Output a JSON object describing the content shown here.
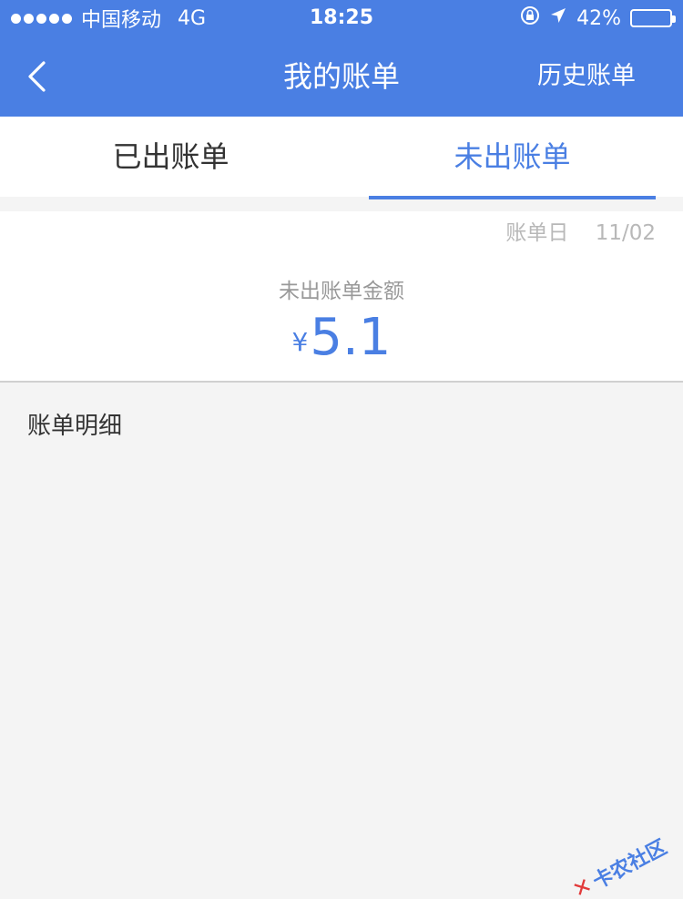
{
  "status_bar": {
    "carrier": "中国移动",
    "network": "4G",
    "time": "18:25",
    "battery": "42%",
    "battery_level": 0.42
  },
  "nav": {
    "title": "我的账单",
    "history": "历史账单"
  },
  "tabs": [
    {
      "label": "已出账单",
      "active": false
    },
    {
      "label": "未出账单",
      "active": true
    }
  ],
  "summary": {
    "date_label": "账单日",
    "date_value": "11/02",
    "amount_label": "未出账单金额",
    "currency": "¥",
    "amount": "5.1"
  },
  "detail": {
    "title": "账单明细"
  },
  "watermark": {
    "text": "卡农社区"
  },
  "colors": {
    "accent": "#4a7fe3",
    "background": "#f4f4f4"
  }
}
